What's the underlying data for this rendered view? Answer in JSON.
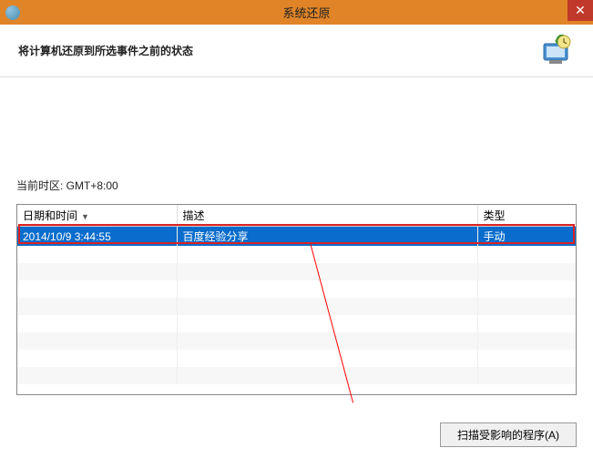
{
  "titlebar": {
    "title": "系统还原",
    "close_label": "✕"
  },
  "header": {
    "subtitle": "将计算机还原到所选事件之前的状态"
  },
  "timezone": {
    "label": "当前时区: GMT+8:00"
  },
  "table": {
    "columns": {
      "datetime": "日期和时间",
      "description": "描述",
      "type": "类型"
    },
    "rows": [
      {
        "datetime": "2014/10/9 3:44:55",
        "description": "百度经验分享",
        "type": "手动"
      }
    ]
  },
  "footer": {
    "scan_button": "扫描受影响的程序(A)"
  }
}
